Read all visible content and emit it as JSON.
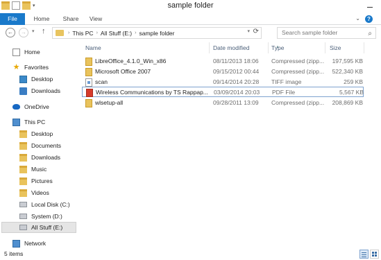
{
  "window": {
    "title": "sample folder"
  },
  "ribbon": {
    "tabs": [
      "File",
      "Home",
      "Share",
      "View"
    ],
    "help": "?"
  },
  "address": {
    "breadcrumbs": [
      "This PC",
      "All Stuff (E:)",
      "sample folder"
    ],
    "separator": "›",
    "search_placeholder": "Search sample folder"
  },
  "nav": {
    "home": "Home",
    "favorites": "Favorites",
    "desktop_fav": "Desktop",
    "downloads_fav": "Downloads",
    "onedrive": "OneDrive",
    "this_pc": "This PC",
    "desktop": "Desktop",
    "documents": "Documents",
    "downloads": "Downloads",
    "music": "Music",
    "pictures": "Pictures",
    "videos": "Videos",
    "local_disk": "Local Disk (C:)",
    "system": "System (D:)",
    "all_stuff": "All Stuff (E:)",
    "network": "Network"
  },
  "columns": {
    "name": "Name",
    "date": "Date modified",
    "type": "Type",
    "size": "Size"
  },
  "files": [
    {
      "name": "LibreOffice_4.1.0_Win_x86",
      "date": "08/11/2013 18:06",
      "type": "Compressed (zipp...",
      "size": "197,595 KB",
      "icon": "zip-icon"
    },
    {
      "name": "Microsoft Office 2007",
      "date": "09/15/2012 00:44",
      "type": "Compressed (zipp...",
      "size": "522,340 KB",
      "icon": "zip-icon"
    },
    {
      "name": "scan",
      "date": "09/14/2014 20:28",
      "type": "TIFF image",
      "size": "259 KB",
      "icon": "tiff-icon"
    },
    {
      "name": "Wireless Communications by TS Rappap...",
      "date": "03/09/2014 20:03",
      "type": "PDF File",
      "size": "5,567 KB",
      "icon": "pdf-icon"
    },
    {
      "name": "wlsetup-all",
      "date": "09/28/2011 13:09",
      "type": "Compressed (zipp...",
      "size": "208,869 KB",
      "icon": "zip-icon"
    }
  ],
  "status": {
    "item_count": "5 items"
  }
}
